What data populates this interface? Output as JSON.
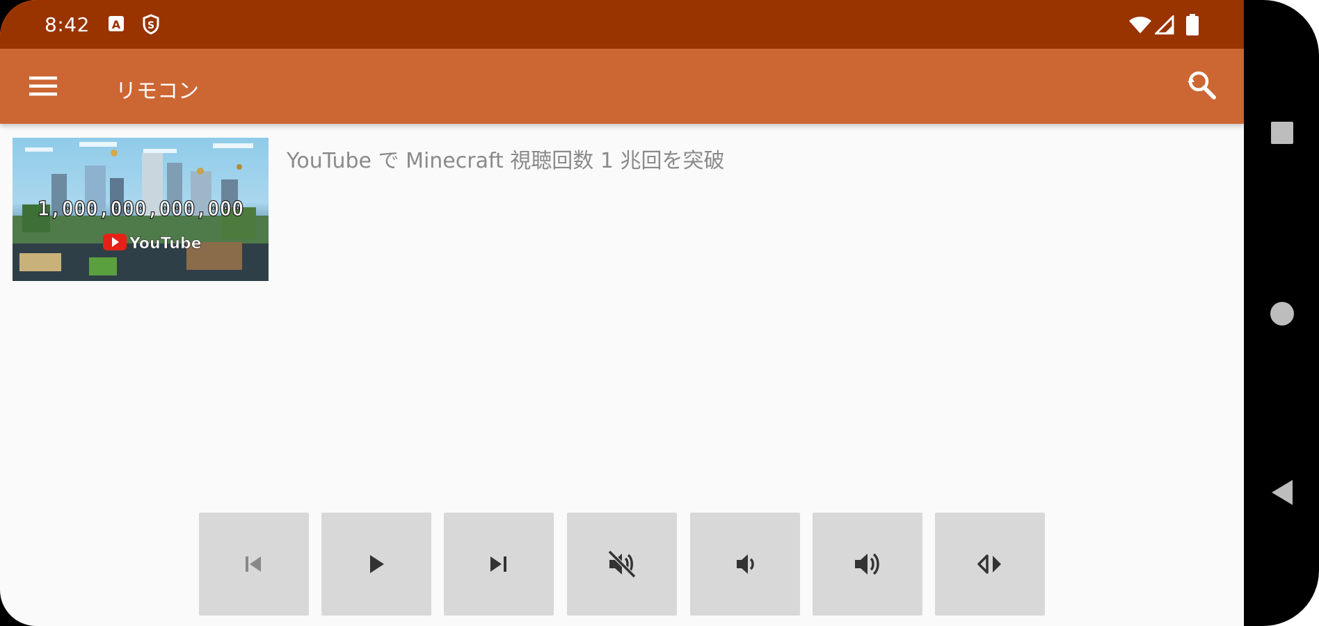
{
  "status_bar": {
    "time": "8:42",
    "icons": [
      "text-a-icon",
      "s-badge-icon",
      "wifi-icon",
      "cellular-icon",
      "battery-icon"
    ]
  },
  "app_bar": {
    "title": "リモコン",
    "menu_icon": "menu-icon",
    "search_icon": "search-icon"
  },
  "video": {
    "title": "YouTube で Minecraft 視聴回数 1 兆回を突破",
    "thumbnail": {
      "count_text": "1,000,000,000,000",
      "brand_text": "YouTube"
    }
  },
  "controls": [
    {
      "name": "previous",
      "icon": "skip-previous-icon"
    },
    {
      "name": "play",
      "icon": "play-icon"
    },
    {
      "name": "next",
      "icon": "skip-next-icon"
    },
    {
      "name": "mute",
      "icon": "volume-off-icon"
    },
    {
      "name": "volume-down",
      "icon": "volume-down-icon"
    },
    {
      "name": "volume-up",
      "icon": "volume-up-icon"
    },
    {
      "name": "seek",
      "icon": "seek-arrows-icon"
    }
  ],
  "system_nav": [
    "recents-icon",
    "home-icon",
    "back-icon"
  ],
  "colors": {
    "status_bar": "#993300",
    "app_bar": "#cc6633",
    "background": "#fafafa",
    "control_button": "#d8d8d8",
    "control_icon": "#333333",
    "title_text": "#8a8a8a"
  }
}
